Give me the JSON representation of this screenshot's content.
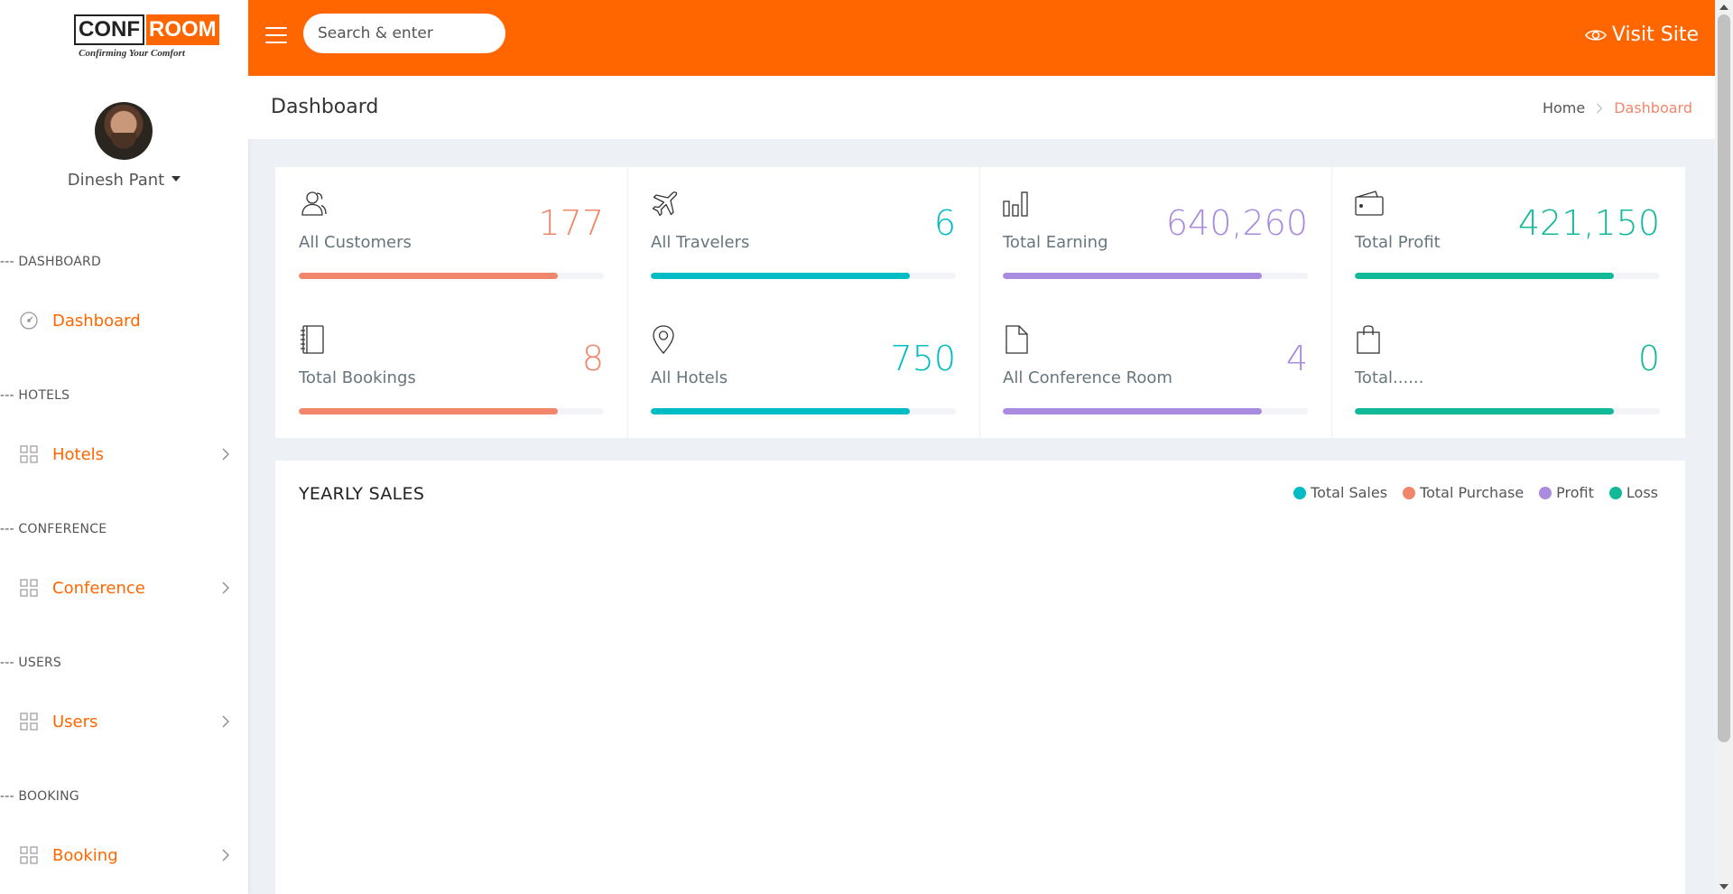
{
  "brand": {
    "logo_left": "CONF",
    "logo_right": "ROOM",
    "tagline": "Confirming Your Comfort",
    "accent": "#ff6600"
  },
  "user": {
    "name": "Dinesh Pant"
  },
  "sidebar": {
    "sections": [
      {
        "caption": "--- DASHBOARD",
        "item": "Dashboard",
        "icon": "gauge-icon",
        "has_chevron": false
      },
      {
        "caption": "--- HOTELS",
        "item": "Hotels",
        "icon": "grid-icon",
        "has_chevron": true
      },
      {
        "caption": "--- CONFERENCE",
        "item": "Conference",
        "icon": "grid-icon",
        "has_chevron": true
      },
      {
        "caption": "--- USERS",
        "item": "Users",
        "icon": "grid-icon",
        "has_chevron": true
      },
      {
        "caption": "--- BOOKING",
        "item": "Booking",
        "icon": "grid-icon",
        "has_chevron": true
      }
    ]
  },
  "topbar": {
    "search_placeholder": "Search & enter",
    "visit_label": "Visit Site"
  },
  "page": {
    "title": "Dashboard",
    "breadcrumb_home": "Home",
    "breadcrumb_current": "Dashboard"
  },
  "stats": [
    {
      "label": "All Customers",
      "value": "177",
      "icon": "users-icon",
      "color": "#f0876b",
      "progress": 0.85
    },
    {
      "label": "All Travelers",
      "value": "6",
      "icon": "plane-icon",
      "color": "#00bcc4",
      "progress": 0.85
    },
    {
      "label": "Total Earning",
      "value": "640,260",
      "icon": "bar-chart-icon",
      "color": "#a98be0",
      "progress": 0.85
    },
    {
      "label": "Total Profit",
      "value": "421,150",
      "icon": "wallet-icon",
      "color": "#11b998",
      "progress": 0.85
    },
    {
      "label": "Total Bookings",
      "value": "8",
      "icon": "notebook-icon",
      "color": "#f0876b",
      "progress": 0.85
    },
    {
      "label": "All Hotels",
      "value": "750",
      "icon": "location-pin-icon",
      "color": "#00bcc4",
      "progress": 0.85
    },
    {
      "label": "All Conference Room",
      "value": "4",
      "icon": "file-icon",
      "color": "#a98be0",
      "progress": 0.85
    },
    {
      "label": "Total......",
      "value": "0",
      "icon": "shopping-bag-icon",
      "color": "#11b998",
      "progress": 0.85
    }
  ],
  "sales": {
    "title": "YEARLY SALES",
    "legend": [
      {
        "name": "Total Sales",
        "color": "#00bcc4"
      },
      {
        "name": "Total Purchase",
        "color": "#f0876b"
      },
      {
        "name": "Profit",
        "color": "#a98be0"
      },
      {
        "name": "Loss",
        "color": "#11b998"
      }
    ]
  }
}
